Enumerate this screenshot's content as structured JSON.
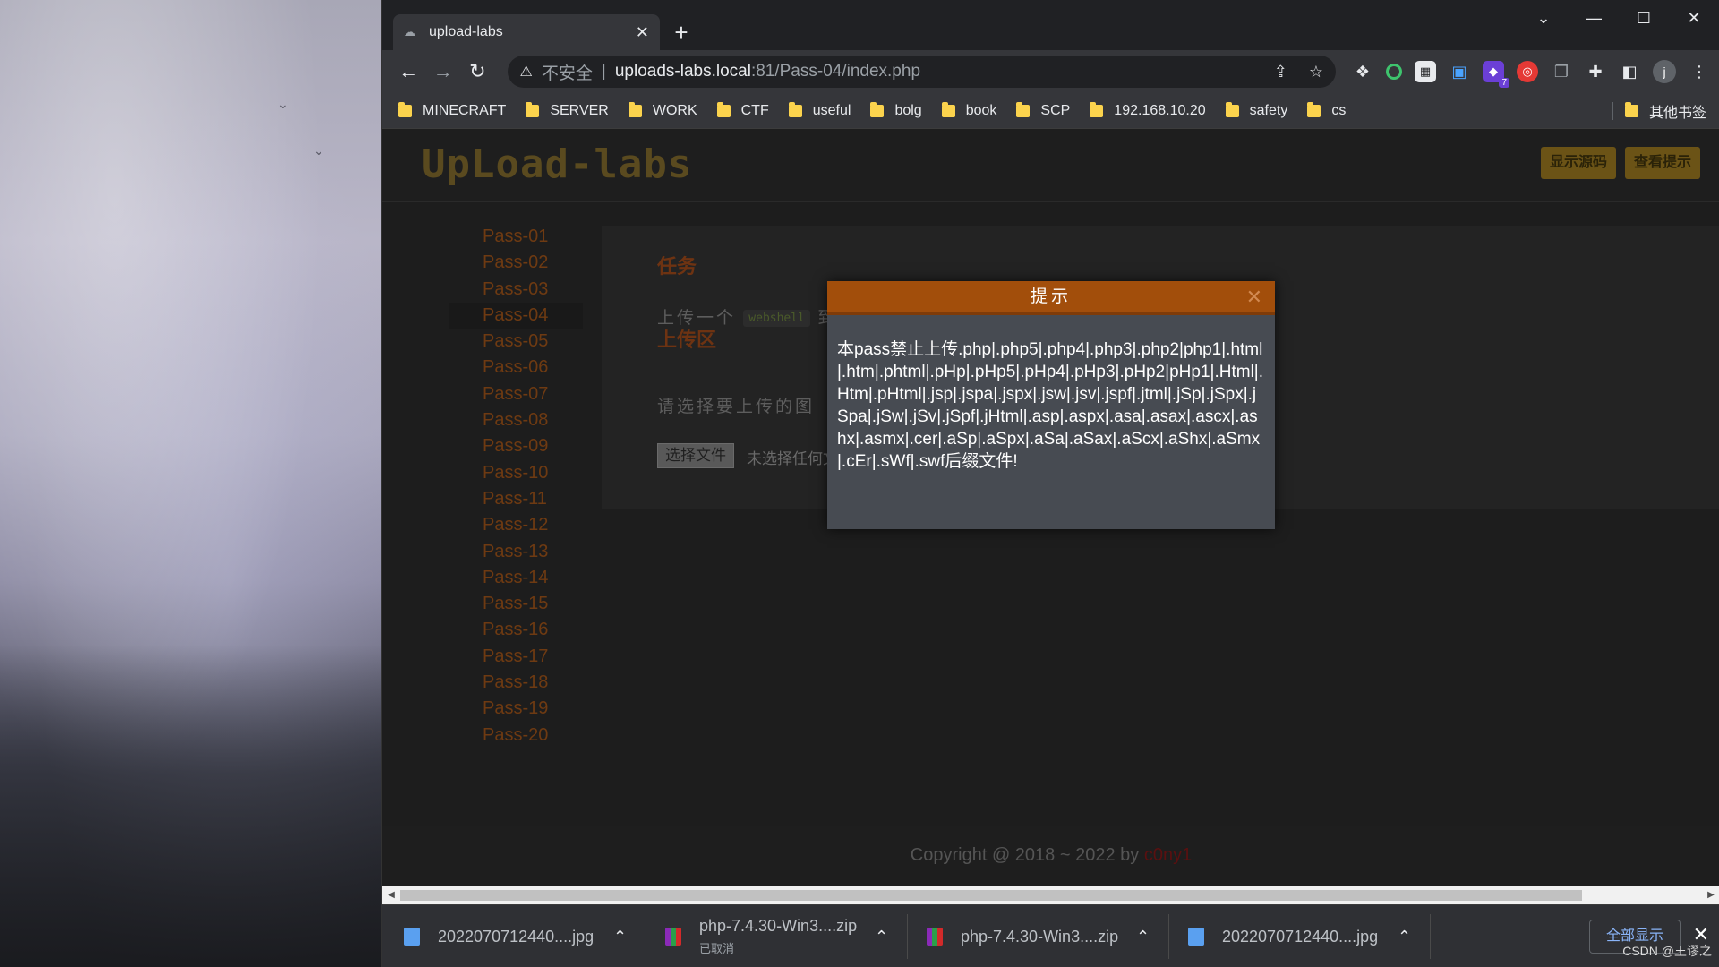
{
  "browser": {
    "tab_title": "upload-labs",
    "address": {
      "insecure_label": "不安全",
      "host": "uploads-labs.local",
      "path": ":81/Pass-04/index.php"
    },
    "bookmarks": [
      "MINECRAFT",
      "SERVER",
      "WORK",
      "CTF",
      "useful",
      "bolg",
      "book",
      "SCP",
      "192.168.10.20",
      "safety",
      "cs"
    ],
    "other_bookmarks": "其他书签",
    "ext_badge": "7",
    "avatar_letter": "j"
  },
  "page": {
    "logo": "UpLoad-labs",
    "buttons": {
      "show_source": "显示源码",
      "show_hint": "查看提示"
    },
    "passes": [
      "Pass-01",
      "Pass-02",
      "Pass-03",
      "Pass-04",
      "Pass-05",
      "Pass-06",
      "Pass-07",
      "Pass-08",
      "Pass-09",
      "Pass-10",
      "Pass-11",
      "Pass-12",
      "Pass-13",
      "Pass-14",
      "Pass-15",
      "Pass-16",
      "Pass-17",
      "Pass-18",
      "Pass-19",
      "Pass-20"
    ],
    "active_pass": "Pass-04",
    "task_title": "任务",
    "task_text_before": "上传一个",
    "task_code": "webshell",
    "task_text_after": "到",
    "upload_title": "上传区",
    "upload_text": "请选择要上传的图",
    "file_button": "选择文件",
    "file_none": "未选择任何文",
    "footer_prefix": "Copyright @ 2018 ~ 2022 by ",
    "footer_author": "c0ny1"
  },
  "modal": {
    "title": "提示",
    "message": "本pass禁止上传.php|.php5|.php4|.php3|.php2|php1|.html|.htm|.phtml|.pHp|.pHp5|.pHp4|.pHp3|.pHp2|pHp1|.Html|.Htm|.pHtml|.jsp|.jspa|.jspx|.jsw|.jsv|.jspf|.jtml|.jSp|.jSpx|.jSpa|.jSw|.jSv|.jSpf|.jHtml|.asp|.aspx|.asa|.asax|.ascx|.ashx|.asmx|.cer|.aSp|.aSpx|.aSa|.aSax|.aScx|.aShx|.aSmx|.cEr|.sWf|.swf后缀文件!"
  },
  "downloads": [
    {
      "name": "2022070712440....jpg",
      "sub": "",
      "icon": "image-file-icon"
    },
    {
      "name": "php-7.4.30-Win3....zip",
      "sub": "已取消",
      "icon": "winrar-icon"
    },
    {
      "name": "php-7.4.30-Win3....zip",
      "sub": "",
      "icon": "winrar-icon"
    },
    {
      "name": "2022070712440....jpg",
      "sub": "",
      "icon": "image-file-icon"
    }
  ],
  "show_all": "全部显示",
  "watermark": "CSDN @王谬之"
}
